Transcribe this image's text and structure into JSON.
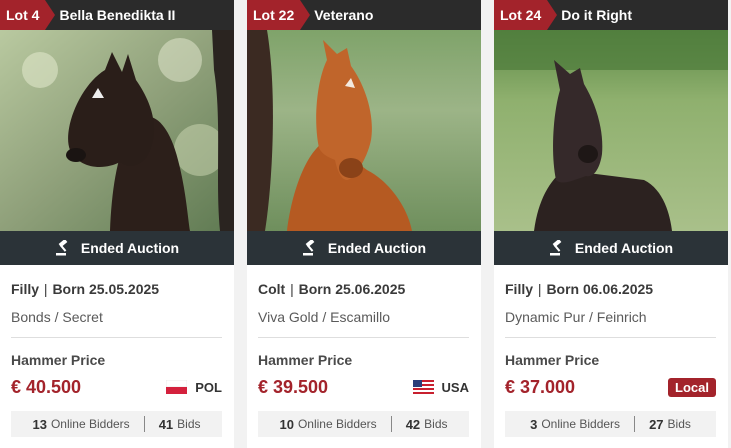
{
  "cards": [
    {
      "lot": "Lot 4",
      "name": "Bella Benedikta II",
      "photo_icon": "foal-photo",
      "status": "Ended Auction",
      "sex": "Filly",
      "born": "Born 25.05.2025",
      "pedigree": "Bonds / Secret",
      "hammer_label": "Hammer Price",
      "price": "€ 40.500",
      "country": "POL",
      "country_flag": "poland-flag-icon",
      "online_bidders": "13",
      "online_bidders_label": "Online Bidders",
      "bids": "41",
      "bids_label": "Bids"
    },
    {
      "lot": "Lot 22",
      "name": "Veterano",
      "photo_icon": "foal-photo",
      "status": "Ended Auction",
      "sex": "Colt",
      "born": "Born 25.06.2025",
      "pedigree": "Viva Gold / Escamillo",
      "hammer_label": "Hammer Price",
      "price": "€ 39.500",
      "country": "USA",
      "country_flag": "usa-flag-icon",
      "online_bidders": "10",
      "online_bidders_label": "Online Bidders",
      "bids": "42",
      "bids_label": "Bids"
    },
    {
      "lot": "Lot 24",
      "name": "Do it Right",
      "photo_icon": "foal-photo",
      "status": "Ended Auction",
      "sex": "Filly",
      "born": "Born 06.06.2025",
      "pedigree": "Dynamic Pur / Feinrich",
      "hammer_label": "Hammer Price",
      "price": "€ 37.000",
      "local_badge": "Local",
      "online_bidders": "3",
      "online_bidders_label": "Online Bidders",
      "bids": "27",
      "bids_label": "Bids"
    }
  ],
  "colors": {
    "accent": "#a3232b",
    "header": "#2b2b2b",
    "status_bar": "#2b3338"
  },
  "separator": "|"
}
